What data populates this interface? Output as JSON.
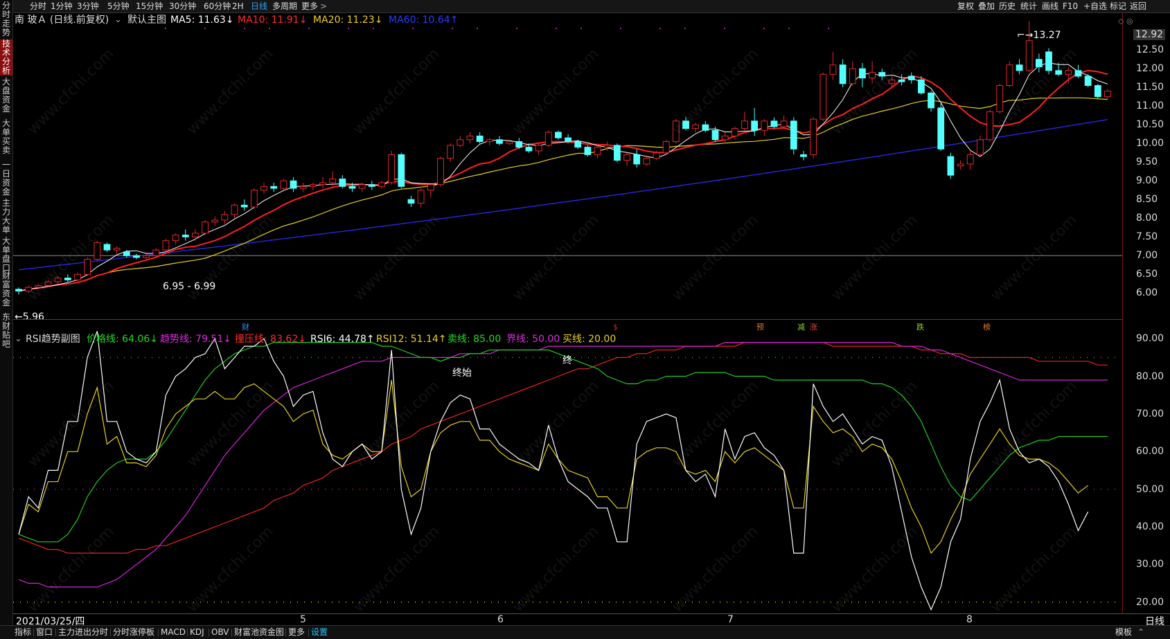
{
  "left_nav": [
    {
      "label": "分时走势",
      "active": false
    },
    {
      "label": "技术分析",
      "active": true
    },
    {
      "label": "大盘资金",
      "active": false
    },
    {
      "label": "大单买卖",
      "active": false
    },
    {
      "label": "一日资金",
      "active": false
    },
    {
      "label": "主力大单",
      "active": false
    },
    {
      "label": "大单盘口",
      "active": false
    },
    {
      "label": "财富资金",
      "active": false
    },
    {
      "label": "东财贴吧",
      "active": false
    }
  ],
  "toolbar": {
    "periods": [
      "分时",
      "1分钟",
      "3分钟",
      "5分钟",
      "15分钟",
      "30分钟",
      "60分钟",
      "2H",
      "日线",
      "多周期",
      "更多"
    ],
    "selected_period": "日线",
    "more_arrow": ">",
    "right_items": [
      "复权",
      "叠加",
      "历史",
      "统计",
      "画线",
      "F10",
      "+自选",
      "标记",
      "返回"
    ]
  },
  "main_legend": {
    "stock": "南 玻Ａ (日线.前复权)",
    "theme": "默认主图",
    "ma5": "MA5: 11.63↓",
    "ma10": "MA10: 11.91↓",
    "ma20": "MA20: 11.23↓",
    "ma60": "MA60: 10.64↑"
  },
  "colors": {
    "up": "#e8262a",
    "down": "#54ffff",
    "ma5": "#ffffff",
    "ma10": "#ff2020",
    "ma20": "#e6d21e",
    "ma60": "#2424d8",
    "rsi6": "#ffffff",
    "rsi12": "#e6d21e",
    "price_line": "#22cc22",
    "trend_line": "#dd22dd",
    "press_line": "#ee2222"
  },
  "price_axis": [
    "12.92",
    "12.50",
    "12.00",
    "11.50",
    "11.00",
    "10.50",
    "10.00",
    "9.50",
    "9.00",
    "8.50",
    "8.00",
    "7.50",
    "7.00",
    "6.50",
    "6.00"
  ],
  "annotations": {
    "high": "13.27",
    "low": "5.96",
    "range": "6.95 - 6.99"
  },
  "event_markers": [
    {
      "text": "财",
      "color": "#3b8cff"
    },
    {
      "text": "$",
      "color": "#d82020"
    },
    {
      "text": "预",
      "color": "#e07a2a"
    },
    {
      "text": "减",
      "color": "#8bd42a"
    },
    {
      "text": "涨",
      "color": "#e04040"
    },
    {
      "text": "跌",
      "color": "#8bd42a"
    },
    {
      "text": "榜",
      "color": "#e07a2a"
    }
  ],
  "sub_legend": {
    "title": "RSI趋势副图",
    "price_line": "价格线: 64.06↓",
    "trend_line": "趋势线: 79.51↓",
    "press_line": "撞压线: 83.62↓",
    "rsi6": "RSI6: 44.78↑",
    "rsi12": "RSI12: 51.14↑",
    "sell_line": "卖线: 85.00",
    "bound_line": "界线: 50.00",
    "buy_line": "买线: 20.00"
  },
  "sub_axis": [
    "90.00",
    "80.00",
    "70.00",
    "60.00",
    "50.00",
    "40.00",
    "30.00",
    "20.00"
  ],
  "sub_labels": {
    "start_end": "终始",
    "end": "终"
  },
  "date_axis": {
    "first": "2021/03/25/四",
    "months": [
      "5",
      "6",
      "7",
      "8"
    ],
    "period": "日线"
  },
  "bottom_tabs": [
    "指标",
    "窗口",
    "主力进出分时",
    "分时涨停板",
    "MACD",
    "KDJ",
    "OBV",
    "财富池资金图",
    "更多",
    "设置"
  ],
  "bottom_selected": "设置",
  "bottom_right": "模板",
  "watermark": "www.cfchi.com",
  "chart_data": {
    "type": "candlestick",
    "title": "南 玻Ａ (日线.前复权)",
    "price_ylim": [
      5.8,
      13.3
    ],
    "candles_ohlc": [
      [
        6.1,
        6.15,
        5.96,
        6.05
      ],
      [
        6.05,
        6.2,
        6.0,
        6.15
      ],
      [
        6.15,
        6.25,
        6.1,
        6.2
      ],
      [
        6.2,
        6.35,
        6.15,
        6.3
      ],
      [
        6.3,
        6.45,
        6.25,
        6.4
      ],
      [
        6.4,
        6.5,
        6.3,
        6.35
      ],
      [
        6.35,
        6.55,
        6.3,
        6.5
      ],
      [
        6.5,
        6.95,
        6.45,
        6.9
      ],
      [
        6.9,
        7.4,
        6.85,
        7.35
      ],
      [
        7.3,
        7.35,
        7.1,
        7.15
      ],
      [
        7.15,
        7.25,
        7.05,
        7.2
      ],
      [
        7.1,
        7.15,
        6.95,
        7.0
      ],
      [
        7.0,
        7.05,
        6.9,
        6.95
      ],
      [
        6.95,
        7.05,
        6.9,
        7.0
      ],
      [
        7.0,
        7.2,
        6.95,
        7.15
      ],
      [
        7.15,
        7.45,
        7.1,
        7.4
      ],
      [
        7.4,
        7.6,
        7.3,
        7.55
      ],
      [
        7.55,
        7.7,
        7.4,
        7.5
      ],
      [
        7.5,
        7.7,
        7.4,
        7.6
      ],
      [
        7.6,
        7.95,
        7.55,
        7.9
      ],
      [
        7.9,
        8.05,
        7.8,
        7.95
      ],
      [
        7.95,
        8.2,
        7.85,
        8.1
      ],
      [
        8.1,
        8.4,
        8.0,
        8.35
      ],
      [
        8.35,
        8.5,
        8.2,
        8.3
      ],
      [
        8.3,
        8.8,
        8.25,
        8.75
      ],
      [
        8.75,
        8.95,
        8.65,
        8.85
      ],
      [
        8.85,
        8.95,
        8.7,
        8.8
      ],
      [
        8.8,
        9.05,
        8.75,
        9.0
      ],
      [
        9.0,
        9.1,
        8.7,
        8.8
      ],
      [
        8.8,
        8.95,
        8.7,
        8.85
      ],
      [
        8.85,
        8.95,
        8.75,
        8.9
      ],
      [
        8.9,
        9.1,
        8.8,
        8.95
      ],
      [
        8.95,
        9.25,
        8.85,
        9.05
      ],
      [
        9.05,
        9.15,
        8.8,
        8.85
      ],
      [
        8.85,
        8.95,
        8.7,
        8.8
      ],
      [
        8.8,
        8.95,
        8.7,
        8.9
      ],
      [
        8.9,
        9.0,
        8.75,
        8.85
      ],
      [
        8.85,
        9.0,
        8.8,
        8.95
      ],
      [
        8.95,
        9.8,
        8.9,
        9.7
      ],
      [
        9.7,
        9.75,
        8.8,
        8.85
      ],
      [
        8.5,
        8.6,
        8.3,
        8.4
      ],
      [
        8.4,
        8.8,
        8.3,
        8.75
      ],
      [
        8.75,
        8.95,
        8.55,
        8.9
      ],
      [
        8.9,
        9.65,
        8.85,
        9.6
      ],
      [
        9.6,
        10.0,
        9.5,
        9.95
      ],
      [
        9.95,
        10.2,
        9.9,
        10.1
      ],
      [
        10.1,
        10.3,
        10.0,
        10.2
      ],
      [
        10.2,
        10.3,
        10.0,
        10.05
      ],
      [
        10.05,
        10.15,
        9.95,
        10.1
      ],
      [
        10.1,
        10.2,
        9.95,
        10.0
      ],
      [
        10.0,
        10.1,
        9.95,
        10.05
      ],
      [
        10.05,
        10.15,
        9.85,
        9.9
      ],
      [
        9.9,
        10.0,
        9.75,
        9.8
      ],
      [
        9.8,
        10.0,
        9.7,
        9.95
      ],
      [
        9.95,
        10.35,
        9.9,
        10.3
      ],
      [
        10.3,
        10.35,
        10.1,
        10.15
      ],
      [
        10.15,
        10.25,
        10.0,
        10.05
      ],
      [
        10.05,
        10.1,
        9.85,
        9.9
      ],
      [
        9.9,
        9.95,
        9.65,
        9.7
      ],
      [
        9.7,
        9.95,
        9.6,
        9.9
      ],
      [
        9.9,
        10.05,
        9.8,
        9.95
      ],
      [
        9.95,
        10.0,
        9.5,
        9.55
      ],
      [
        9.55,
        9.75,
        9.4,
        9.7
      ],
      [
        9.7,
        9.85,
        9.35,
        9.45
      ],
      [
        9.45,
        9.7,
        9.4,
        9.6
      ],
      [
        9.6,
        9.8,
        9.55,
        9.75
      ],
      [
        9.75,
        10.1,
        9.7,
        10.05
      ],
      [
        10.05,
        10.65,
        10.0,
        10.6
      ],
      [
        10.6,
        10.7,
        10.35,
        10.4
      ],
      [
        10.4,
        10.55,
        10.3,
        10.5
      ],
      [
        10.5,
        10.6,
        10.3,
        10.35
      ],
      [
        10.35,
        10.45,
        10.05,
        10.1
      ],
      [
        10.1,
        10.3,
        10.0,
        10.2
      ],
      [
        10.2,
        10.45,
        10.1,
        10.4
      ],
      [
        10.4,
        10.85,
        10.35,
        10.6
      ],
      [
        10.6,
        10.95,
        10.2,
        10.35
      ],
      [
        10.35,
        10.65,
        10.2,
        10.6
      ],
      [
        10.6,
        10.7,
        10.4,
        10.45
      ],
      [
        10.45,
        10.75,
        10.4,
        10.6
      ],
      [
        10.6,
        10.7,
        9.7,
        9.85
      ],
      [
        9.7,
        9.8,
        9.55,
        9.65
      ],
      [
        9.7,
        10.7,
        9.6,
        10.65
      ],
      [
        10.65,
        11.9,
        10.6,
        11.85
      ],
      [
        11.85,
        12.45,
        11.7,
        12.1
      ],
      [
        12.1,
        12.25,
        11.5,
        11.6
      ],
      [
        11.6,
        12.2,
        11.55,
        12.0
      ],
      [
        12.0,
        12.15,
        11.5,
        11.75
      ],
      [
        11.75,
        12.2,
        11.6,
        11.9
      ],
      [
        11.9,
        12.0,
        11.7,
        11.8
      ],
      [
        11.6,
        11.8,
        11.5,
        11.7
      ],
      [
        11.7,
        11.85,
        11.55,
        11.65
      ],
      [
        11.8,
        11.9,
        11.6,
        11.7
      ],
      [
        11.7,
        11.8,
        11.3,
        11.35
      ],
      [
        11.35,
        11.4,
        10.85,
        10.95
      ],
      [
        10.95,
        11.1,
        9.8,
        9.85
      ],
      [
        9.65,
        9.75,
        9.05,
        9.15
      ],
      [
        9.4,
        9.55,
        9.3,
        9.45
      ],
      [
        9.45,
        9.8,
        9.3,
        9.7
      ],
      [
        9.7,
        10.2,
        9.65,
        10.1
      ],
      [
        10.1,
        10.9,
        10.05,
        10.85
      ],
      [
        10.85,
        11.6,
        10.8,
        11.55
      ],
      [
        11.55,
        12.2,
        11.5,
        12.1
      ],
      [
        12.1,
        12.25,
        11.85,
        11.95
      ],
      [
        11.95,
        13.27,
        11.9,
        12.75
      ],
      [
        12.25,
        12.4,
        11.9,
        12.05
      ],
      [
        12.45,
        12.55,
        11.85,
        11.95
      ],
      [
        11.95,
        12.15,
        11.8,
        11.85
      ],
      [
        11.85,
        12.05,
        11.6,
        11.95
      ],
      [
        11.95,
        12.1,
        11.75,
        11.8
      ],
      [
        11.8,
        11.85,
        11.5,
        11.55
      ],
      [
        11.55,
        11.6,
        11.2,
        11.25
      ],
      [
        11.25,
        11.45,
        11.2,
        11.4
      ]
    ],
    "ma60_start": 6.62,
    "ma60_end": 10.64,
    "rsi_ylim": [
      17,
      95
    ],
    "rsi6": [
      38,
      48,
      45,
      55,
      55,
      68,
      68,
      85,
      92,
      68,
      68,
      60,
      58,
      57,
      60,
      75,
      80,
      82,
      85,
      86,
      90,
      82,
      85,
      88,
      88,
      90,
      84,
      80,
      72,
      75,
      76,
      65,
      58,
      56,
      60,
      62,
      58,
      60,
      87,
      50,
      38,
      45,
      60,
      68,
      73,
      75,
      74,
      66,
      66,
      62,
      60,
      58,
      57,
      55,
      67,
      58,
      52,
      50,
      48,
      45,
      45,
      36,
      36,
      62,
      68,
      69,
      70,
      69,
      55,
      52,
      54,
      48,
      66,
      58,
      64,
      65,
      61,
      59,
      55,
      33,
      33,
      78,
      72,
      68,
      70,
      66,
      62,
      64,
      63,
      56,
      44,
      32,
      24,
      18,
      24,
      36,
      42,
      58,
      68,
      73,
      79,
      66,
      60,
      57,
      58,
      56,
      52,
      46,
      39,
      44
    ],
    "rsi12": [
      38,
      46,
      44,
      52,
      52,
      60,
      60,
      70,
      77,
      62,
      64,
      57,
      57,
      56,
      59,
      66,
      70,
      72,
      74,
      74,
      76,
      74,
      74,
      77,
      78,
      76,
      74,
      72,
      68,
      70,
      71,
      62,
      59,
      58,
      60,
      62,
      60,
      60,
      79,
      56,
      48,
      50,
      60,
      65,
      67,
      68,
      68,
      63,
      63,
      60,
      58,
      57,
      56,
      55,
      62,
      58,
      55,
      54,
      53,
      48,
      48,
      45,
      45,
      58,
      60,
      61,
      61,
      60,
      55,
      54,
      55,
      52,
      60,
      57,
      60,
      61,
      59,
      57,
      55,
      45,
      45,
      72,
      68,
      65,
      66,
      64,
      60,
      62,
      61,
      58,
      52,
      45,
      40,
      33,
      36,
      42,
      47,
      54,
      58,
      62,
      66,
      62,
      59,
      58,
      58,
      57,
      55,
      52,
      49,
      51
    ],
    "price_line": [
      38,
      37,
      36,
      36,
      36,
      38,
      42,
      48,
      52,
      55,
      57,
      58,
      58,
      58,
      60,
      63,
      67,
      71,
      75,
      79,
      82,
      84,
      86,
      87,
      88,
      88,
      89,
      89,
      89,
      89,
      89,
      89,
      89,
      89,
      89,
      89,
      89,
      88,
      88,
      87,
      86,
      85,
      85,
      84,
      85,
      85,
      86,
      86,
      87,
      87,
      87,
      87,
      87,
      87,
      87,
      86,
      85,
      84,
      83,
      82,
      80,
      79,
      78,
      78,
      79,
      79,
      80,
      80,
      80,
      81,
      81,
      81,
      81,
      80,
      80,
      80,
      80,
      79,
      79,
      79,
      79,
      79,
      79,
      79,
      79,
      79,
      79,
      78,
      78,
      77,
      75,
      72,
      68,
      62,
      56,
      51,
      48,
      47,
      50,
      53,
      56,
      59,
      61,
      62,
      63,
      63,
      64,
      64,
      64,
      64,
      64,
      64
    ],
    "trend_line": [
      26,
      25,
      25,
      24,
      24,
      24,
      24,
      24,
      24,
      25,
      26,
      28,
      30,
      32,
      34,
      37,
      40,
      43,
      47,
      51,
      55,
      59,
      62,
      65,
      68,
      71,
      73,
      75,
      77,
      78,
      79,
      80,
      81,
      82,
      83,
      84,
      84,
      84,
      85,
      85,
      85,
      85,
      85,
      85,
      85,
      86,
      86,
      86,
      86,
      87,
      87,
      87,
      87,
      87,
      88,
      88,
      88,
      88,
      88,
      88,
      88,
      88,
      88,
      88,
      88,
      88,
      88,
      88,
      88,
      88,
      88,
      88,
      89,
      89,
      89,
      89,
      89,
      89,
      89,
      89,
      89,
      89,
      89,
      89,
      89,
      89,
      89,
      89,
      89,
      89,
      88,
      88,
      88,
      87,
      87,
      86,
      85,
      84,
      83,
      82,
      81,
      80,
      79,
      79,
      79,
      79,
      79,
      79,
      79,
      79,
      79,
      79
    ],
    "press_line": [
      37,
      36,
      35,
      34,
      34,
      33,
      33,
      33,
      33,
      33,
      33,
      33,
      34,
      34,
      35,
      35,
      36,
      37,
      38,
      39,
      40,
      41,
      42,
      43,
      44,
      45,
      47,
      48,
      49,
      51,
      52,
      53,
      55,
      56,
      57,
      58,
      59,
      60,
      62,
      63,
      64,
      66,
      67,
      68,
      69,
      70,
      71,
      72,
      73,
      74,
      75,
      76,
      77,
      78,
      79,
      80,
      81,
      82,
      82,
      83,
      84,
      85,
      85,
      86,
      86,
      87,
      87,
      87,
      88,
      88,
      88,
      88,
      88,
      88,
      89,
      89,
      89,
      89,
      89,
      89,
      89,
      89,
      89,
      88,
      88,
      88,
      88,
      88,
      88,
      88,
      88,
      88,
      87,
      87,
      86,
      86,
      86,
      85,
      85,
      85,
      85,
      85,
      85,
      85,
      84,
      84,
      84,
      84,
      84,
      84,
      83,
      83
    ],
    "levels": {
      "sell": 85,
      "bound": 50,
      "buy": 20
    }
  }
}
